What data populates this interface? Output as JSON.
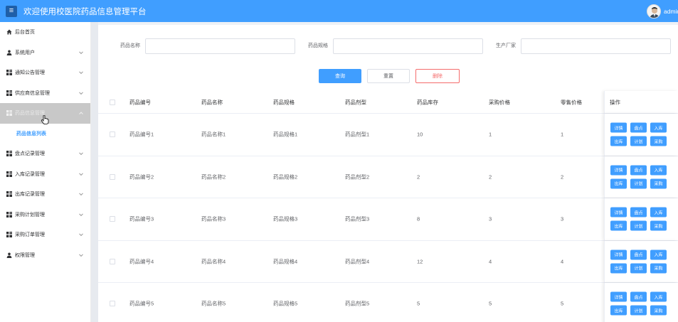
{
  "header": {
    "menu_icon": "hamburger-icon",
    "title": "欢迎使用校医院药品信息管理平台",
    "user_name": "admin"
  },
  "sidebar": {
    "items": [
      {
        "label": "后台首页",
        "icon": "home-icon",
        "has_arrow": false
      },
      {
        "label": "系统用户",
        "icon": "user-icon",
        "has_arrow": true
      },
      {
        "label": "通知公告管理",
        "icon": "grid-icon",
        "has_arrow": true
      },
      {
        "label": "供应商信息管理",
        "icon": "grid-icon",
        "has_arrow": true
      },
      {
        "label": "药品信息管理",
        "icon": "grid-icon",
        "has_arrow": true,
        "active": true
      },
      {
        "label": "盘点记录管理",
        "icon": "grid-icon",
        "has_arrow": true
      },
      {
        "label": "入库记录管理",
        "icon": "grid-icon",
        "has_arrow": true
      },
      {
        "label": "出库记录管理",
        "icon": "grid-icon",
        "has_arrow": true
      },
      {
        "label": "采购计划管理",
        "icon": "grid-icon",
        "has_arrow": true
      },
      {
        "label": "采购订单管理",
        "icon": "grid-icon",
        "has_arrow": true
      },
      {
        "label": "权限管理",
        "icon": "user-icon",
        "has_arrow": true
      }
    ],
    "sub_item": "药品信息列表"
  },
  "search": {
    "name_label": "药品名称",
    "spec_label": "药品规格",
    "maker_label": "生产厂家",
    "name_value": "",
    "spec_value": "",
    "maker_value": ""
  },
  "actions": {
    "query": "查询",
    "reset": "重置",
    "delete": "删除"
  },
  "table": {
    "columns": [
      "药品编号",
      "药品名称",
      "药品规格",
      "药品剂型",
      "药品库存",
      "采购价格",
      "零售价格",
      "操作"
    ],
    "rows": [
      {
        "code": "药品编号1",
        "name": "药品名称1",
        "spec": "药品规格1",
        "form": "药品剂型1",
        "stock": "10",
        "purchase_price": "1",
        "retail_price": "1"
      },
      {
        "code": "药品编号2",
        "name": "药品名称2",
        "spec": "药品规格2",
        "form": "药品剂型2",
        "stock": "2",
        "purchase_price": "2",
        "retail_price": "2"
      },
      {
        "code": "药品编号3",
        "name": "药品名称3",
        "spec": "药品规格3",
        "form": "药品剂型3",
        "stock": "8",
        "purchase_price": "3",
        "retail_price": "3"
      },
      {
        "code": "药品编号4",
        "name": "药品名称4",
        "spec": "药品规格4",
        "form": "药品剂型4",
        "stock": "12",
        "purchase_price": "4",
        "retail_price": "4"
      },
      {
        "code": "药品编号5",
        "name": "药品名称5",
        "spec": "药品规格5",
        "form": "药品剂型5",
        "stock": "5",
        "purchase_price": "5",
        "retail_price": "5"
      }
    ],
    "row_ops": [
      "详情",
      "盘点",
      "入库",
      "出库",
      "计划",
      "采购"
    ]
  },
  "colors": {
    "primary": "#409eff",
    "danger": "#f56c6c",
    "active_menu_bg": "#c8c8c8"
  }
}
